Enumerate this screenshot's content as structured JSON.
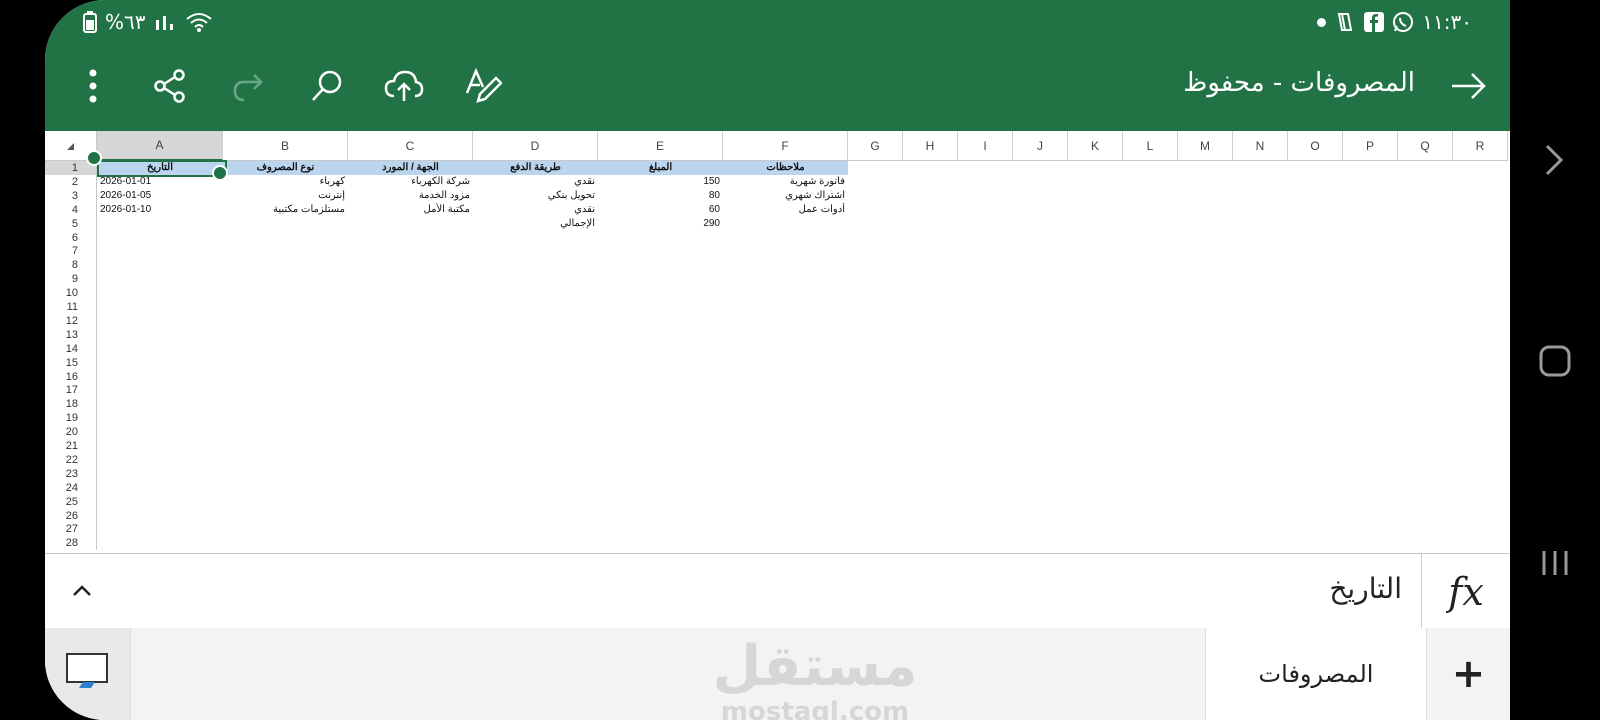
{
  "status": {
    "battery": "%٦٣",
    "time": "١١:٣٠"
  },
  "icons": {
    "more": "more-vertical-icon",
    "share": "share-icon",
    "redo": "redo-icon",
    "search": "search-icon",
    "save": "cloud-upload-icon",
    "draw": "draw-pen-icon",
    "back": "arrow-right-icon"
  },
  "header": {
    "title": "المصروفات - محفوظ"
  },
  "columns": [
    "A",
    "B",
    "C",
    "D",
    "E",
    "F",
    "G",
    "H",
    "I",
    "J",
    "K",
    "L",
    "M",
    "N",
    "O",
    "P",
    "Q",
    "R"
  ],
  "rows": [
    "1",
    "2",
    "3",
    "4",
    "5",
    "6",
    "7",
    "8",
    "9",
    "10",
    "11",
    "12",
    "13",
    "14",
    "15",
    "16",
    "17",
    "18",
    "19",
    "20",
    "21",
    "22",
    "23",
    "24",
    "25",
    "26",
    "27",
    "28"
  ],
  "sheet": {
    "headers": [
      "التاريخ",
      "نوع المصروف",
      "الجهة / المورد",
      "طريقة الدفع",
      "المبلغ",
      "ملاحظات"
    ],
    "data": [
      [
        "2026-01-01",
        "كهرباء",
        "شركة الكهرباء",
        "نقدي",
        "150",
        "فاتورة شهرية"
      ],
      [
        "2026-01-05",
        "إنترنت",
        "مزود الخدمة",
        "تحويل بنكي",
        "80",
        "اشتراك شهري"
      ],
      [
        "2026-01-10",
        "مستلزمات مكتبية",
        "مكتبة الأمل",
        "نقدي",
        "60",
        "أدوات عمل"
      ]
    ],
    "total_label": "الإجمالي",
    "total_value": "290"
  },
  "formula_bar": {
    "fx": "fx",
    "value": "التاريخ"
  },
  "sheet_tabs": {
    "active": "المصروفات",
    "add": "+"
  },
  "watermark": {
    "arabic": "مستقل",
    "latin": "mostaql.com"
  },
  "colors": {
    "brand": "#217346",
    "header_fill": "#bcd5ee"
  }
}
